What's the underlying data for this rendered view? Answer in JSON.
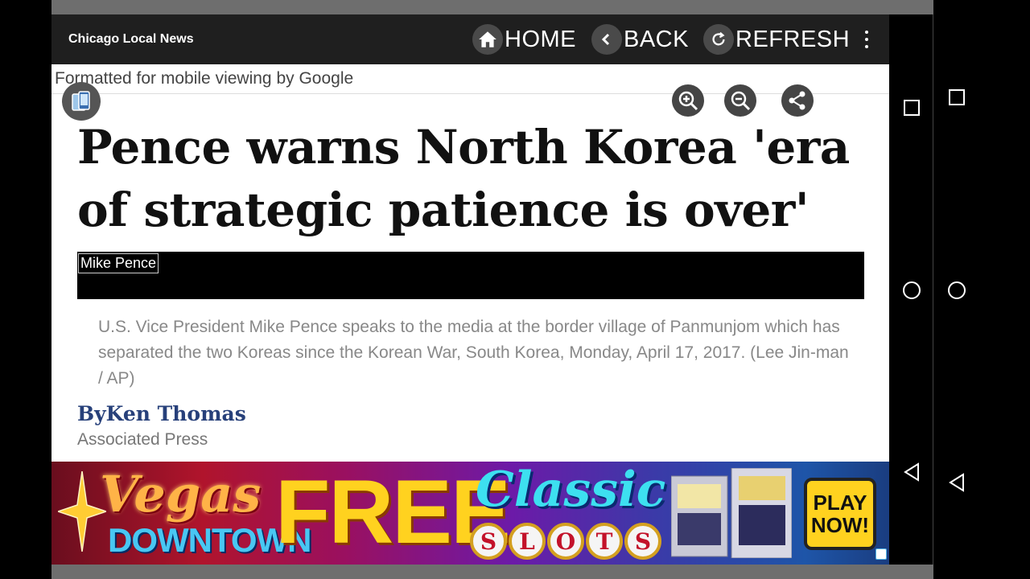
{
  "app": {
    "title": "Chicago Local News"
  },
  "toolbar": {
    "home_label": "HOME",
    "back_label": "BACK",
    "refresh_label": "REFRESH",
    "home_icon": "home-icon",
    "back_icon": "chevron-left-icon",
    "refresh_icon": "refresh-icon",
    "more_icon": "more-vertical-icon"
  },
  "page": {
    "mobile_note": "Formatted for mobile viewing by Google",
    "headline": "Pence warns North Korea 'era of strategic patience is over'",
    "image_alt": "Mike Pence",
    "caption": "U.S. Vice President Mike Pence speaks to the media at the border village of Panmunjom which has separated the two Koreas since the Korean War, South Korea, Monday, April 17, 2017. (Lee Jin-man / AP)",
    "byline": "ByKen Thomas",
    "agency": "Associated Press"
  },
  "controls": {
    "zoom_in_icon": "zoom-in-icon",
    "zoom_out_icon": "zoom-out-icon",
    "share_icon": "share-icon",
    "page_icon": "mobile-view-icon"
  },
  "ad": {
    "brand_line1": "Vegas",
    "brand_line2": "DOWNTOWN",
    "free": "FREE",
    "classic": "Classic",
    "slots_letters": [
      "S",
      "L",
      "O",
      "T",
      "S"
    ],
    "play_line1": "PLAY",
    "play_line2": "NOW!"
  },
  "colors": {
    "toolbar_bg": "#1f1f1f",
    "byline": "#27407a",
    "caption": "#888888"
  }
}
